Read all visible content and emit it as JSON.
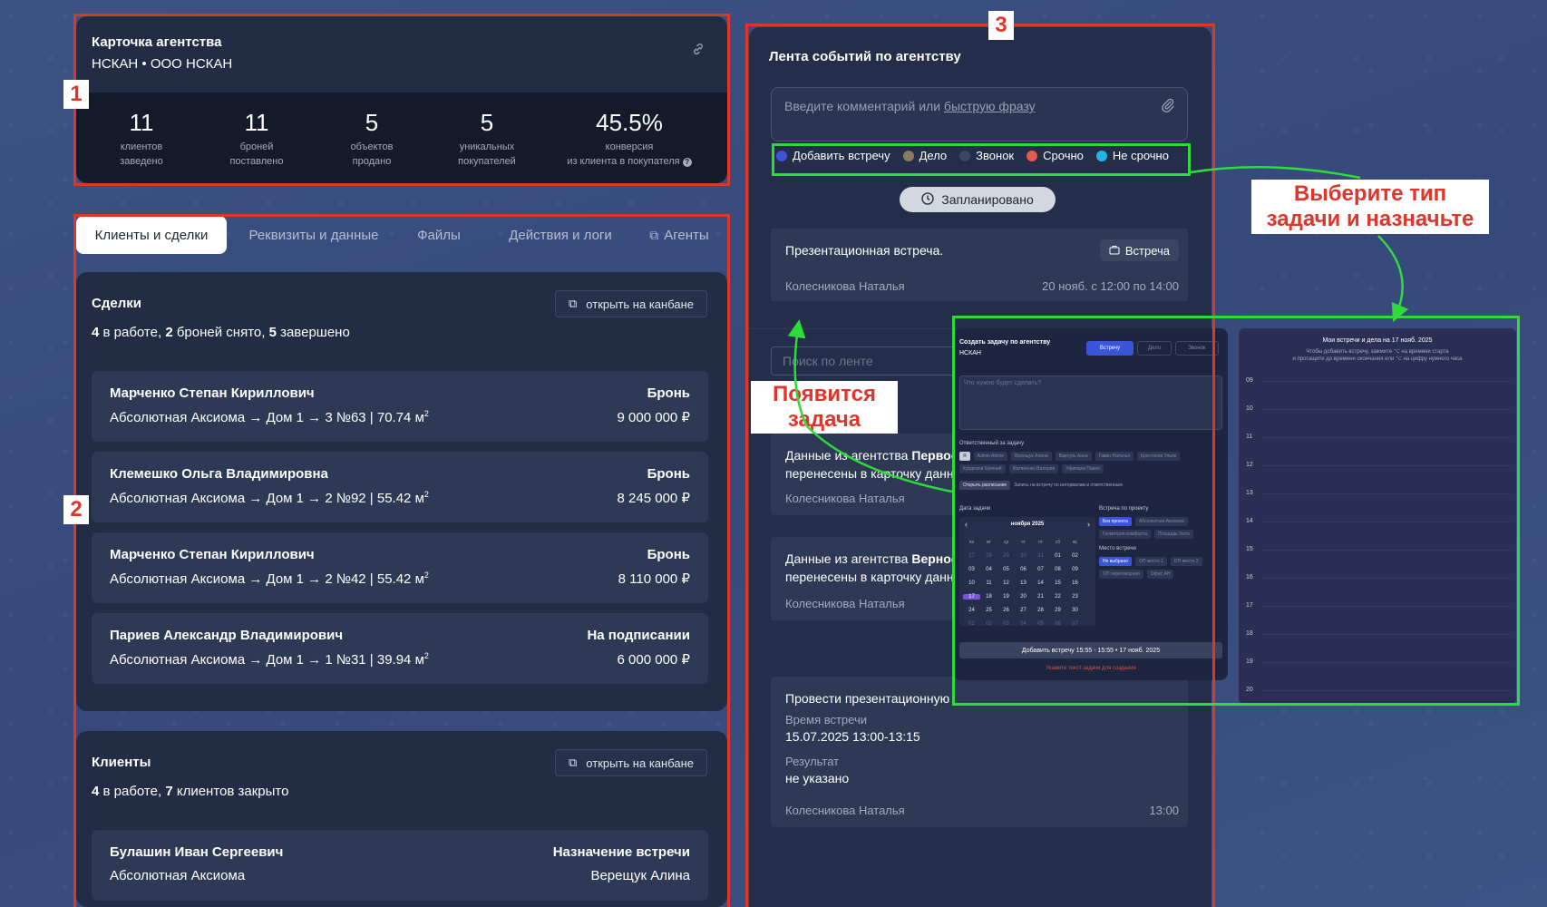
{
  "agency_card": {
    "title": "Карточка агентства",
    "subtitle": "НСКАН • ООО НСКАН",
    "link_icon": "link-icon",
    "stats": [
      {
        "value": "11",
        "label1": "клиентов",
        "label2": "заведено"
      },
      {
        "value": "11",
        "label1": "броней",
        "label2": "поставлено"
      },
      {
        "value": "5",
        "label1": "объектов",
        "label2": "продано"
      },
      {
        "value": "5",
        "label1": "уникальных",
        "label2": "покупателей"
      },
      {
        "value": "45.5%",
        "label1": "конверсия",
        "label2": "из клиента в покупателя"
      }
    ]
  },
  "tabs": [
    "Клиенты и сделки",
    "Реквизиты и данные",
    "Файлы",
    "Действия и логи",
    "Агенты"
  ],
  "deals": {
    "title": "Сделки",
    "open_kanban": "открыть на канбане",
    "summary": {
      "n1": "4",
      "t1": " в работе, ",
      "n2": "2",
      "t2": " броней снято, ",
      "n3": "5",
      "t3": " завершено"
    },
    "items": [
      {
        "name": "Марченко Степан Кириллович",
        "address": "Абсолютная Аксиома → Дом 1 → 3 №63 | 70.74 м",
        "status": "Бронь",
        "price": "9 000 000 ₽"
      },
      {
        "name": "Клемешко Ольга Владимировна",
        "address": "Абсолютная Аксиома → Дом 1 → 2 №92 | 55.42 м",
        "status": "Бронь",
        "price": "8 245 000 ₽"
      },
      {
        "name": "Марченко Степан Кириллович",
        "address": "Абсолютная Аксиома → Дом 1 → 2 №42 | 55.42 м",
        "status": "Бронь",
        "price": "8 110 000 ₽"
      },
      {
        "name": "Париев Александр Владимирович",
        "address": "Абсолютная Аксиома → Дом 1 → 1 №31 | 39.94 м",
        "status": "На подписании",
        "price": "6 000 000 ₽"
      }
    ],
    "sup": "2"
  },
  "clients": {
    "title": "Клиенты",
    "open_kanban": "открыть на канбане",
    "summary": {
      "n1": "4",
      "t1": " в работе, ",
      "n2": "7",
      "t2": " клиентов закрыто"
    },
    "items": [
      {
        "name": "Булашин Иван Сергеевич",
        "project": "Абсолютная Аксиома",
        "status": "Назначение встречи",
        "agent": "Верещук Алина"
      }
    ]
  },
  "feed": {
    "title": "Лента событий по агентству",
    "comment_placeholder": "Введите комментарий или ",
    "comment_link": "быструю фразу",
    "chips": [
      {
        "label": "Добавить встречу",
        "color": "#3b55d9"
      },
      {
        "label": "Дело",
        "color": "#8a7a62"
      },
      {
        "label": "Звонок",
        "color": "#3e4668"
      },
      {
        "label": "Срочно",
        "color": "#e25b4c"
      },
      {
        "label": "Не срочно",
        "color": "#25b3e4"
      }
    ],
    "planned": "Запланировано",
    "events": [
      {
        "title": "Презентационная встреча.",
        "badge": "Встреча",
        "author": "Колесникова Наталья",
        "date": "20 нояб. с 12:00 по 14:00"
      }
    ],
    "search_placeholder": "Поиск по ленте",
    "data_events": [
      {
        "line1a": "Данные из агентства ",
        "line1b": "Первое",
        "line2": "перенесены в карточку данн",
        "author": "Колесникова Наталья"
      },
      {
        "line1a": "Данные из агентства ",
        "line1b": "Верное",
        "line2": "перенесены в карточку данн",
        "author": "Колесникова Наталья"
      }
    ],
    "last_event": {
      "title": "Провести презентационную",
      "time_label": "Время встречи",
      "time_value": "15.07.2025 13:00-13:15",
      "result_label": "Результат",
      "result_value": "не указано",
      "author": "Колесникова Наталья",
      "time": "13:00"
    }
  },
  "task_dialog": {
    "title": "Создать задачу по агентству",
    "subtitle": "НСКАН",
    "types": [
      "Встречу",
      "Дело",
      "Звонок"
    ],
    "placeholder": "Что нужно будет сделать?",
    "responsible_label": "Ответственный за задачу",
    "responsible": [
      "Я",
      "Admin Admin",
      "Верещук Алина",
      "Вартуль Анна",
      "Гавин Наталья",
      "Крестянов Ульян",
      "Курдюков Евгений",
      "Матвеенко Валерия",
      "Уфимцев Павел"
    ],
    "schedule_btn": "Открыть расписание",
    "schedule_hint": "Запись на встречу по интервалам и ответственным",
    "date_label": "Дата задачи",
    "month": "ноября 2025",
    "weekdays": [
      "пн",
      "вт",
      "ср",
      "чт",
      "пт",
      "сб",
      "вс"
    ],
    "days": [
      "27",
      "28",
      "29",
      "30",
      "31",
      "01",
      "02",
      "03",
      "04",
      "05",
      "06",
      "07",
      "08",
      "09",
      "10",
      "11",
      "12",
      "13",
      "14",
      "15",
      "16",
      "17",
      "18",
      "19",
      "20",
      "21",
      "22",
      "23",
      "24",
      "25",
      "26",
      "27",
      "28",
      "29",
      "30",
      "01",
      "02",
      "03",
      "04",
      "05",
      "06",
      "07"
    ],
    "project_label": "Встреча по проекту",
    "projects": [
      "Без проекта",
      "Абсолютная Аксиома",
      "Геометрия комфорта",
      "Площадь Уюта"
    ],
    "place_label": "Место встречи",
    "places": [
      "Не выбрано",
      "ОП место 1",
      "ОП место 2",
      "ОП переговорная",
      "Офис АН"
    ],
    "add_btn": "Добавить встречу 15:55 - 15:55 • 17 нояб. 2025",
    "warning": "Укажите текст задачи для создания"
  },
  "calendar_panel": {
    "title": "Мои встречи и дела на 17 нояб. 2025",
    "hint1": "Чтобы добавить встречу, зажмите ⌥ на времени старта",
    "hint2": "и протащите до времени окончания или ⌥ на цифру нужного часа",
    "hours": [
      "09",
      "10",
      "11",
      "12",
      "13",
      "14",
      "15",
      "16",
      "17",
      "18",
      "19",
      "20"
    ]
  },
  "annotations": {
    "n1": "1",
    "n2": "2",
    "n3": "3",
    "callout_task_l1": "Появится",
    "callout_task_l2": "задача",
    "callout_type_l1": "Выберите тип",
    "callout_type_l2": "задачи и назначьте"
  },
  "colors": {
    "accent_red": "#e0352b",
    "accent_green": "#2ddc3a",
    "purple_selected": "#7b55d8"
  }
}
